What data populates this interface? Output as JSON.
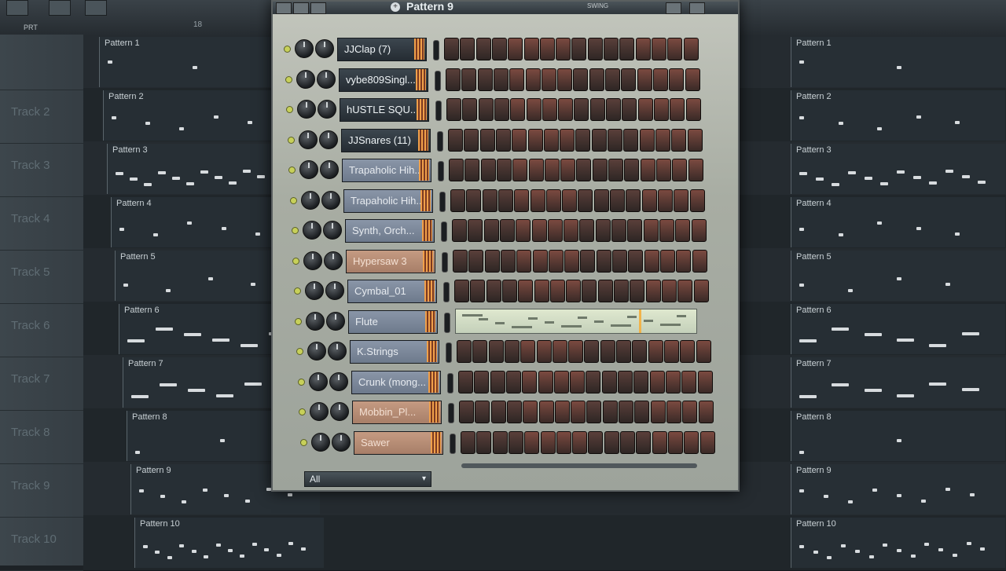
{
  "header": {
    "prt_label": "PRT",
    "ruler_num": "18"
  },
  "tracks": [
    {
      "label": ""
    },
    {
      "label": "Track 2"
    },
    {
      "label": "Track 3"
    },
    {
      "label": "Track 4"
    },
    {
      "label": "Track 5"
    },
    {
      "label": "Track 6"
    },
    {
      "label": "Track 7"
    },
    {
      "label": "Track 8"
    },
    {
      "label": "Track 9"
    },
    {
      "label": "Track 10"
    }
  ],
  "playlist": {
    "clips": [
      "Pattern 1",
      "Pattern 2",
      "Pattern 3",
      "Pattern 4",
      "Pattern 5",
      "Pattern 6",
      "Pattern 7",
      "Pattern 8",
      "Pattern 9",
      "Pattern 10"
    ]
  },
  "sequencer": {
    "title": "Pattern 9",
    "swing_label": "SWING",
    "channel_filter": "All",
    "channels": [
      {
        "name": "JJClap (7)",
        "style": "dark"
      },
      {
        "name": "vybe809Singl...",
        "style": "dark"
      },
      {
        "name": "hUSTLE SQU...",
        "style": "dark"
      },
      {
        "name": "JJSnares (11)",
        "style": "dark"
      },
      {
        "name": "Trapaholic Hih...",
        "style": "light"
      },
      {
        "name": "Trapaholic Hih...",
        "style": "light"
      },
      {
        "name": "Synth, Orch...",
        "style": "light"
      },
      {
        "name": "Hypersaw 3",
        "style": "tan"
      },
      {
        "name": "Cymbal_01",
        "style": "light"
      },
      {
        "name": "Flute",
        "style": "light"
      },
      {
        "name": "K.Strings",
        "style": "light"
      },
      {
        "name": "Crunk (mong...",
        "style": "light"
      },
      {
        "name": "Mobbin_Pl...",
        "style": "tan"
      },
      {
        "name": "Sawer",
        "style": "tan"
      }
    ],
    "steps_per_row": 16,
    "piano_roll_row": 9
  }
}
